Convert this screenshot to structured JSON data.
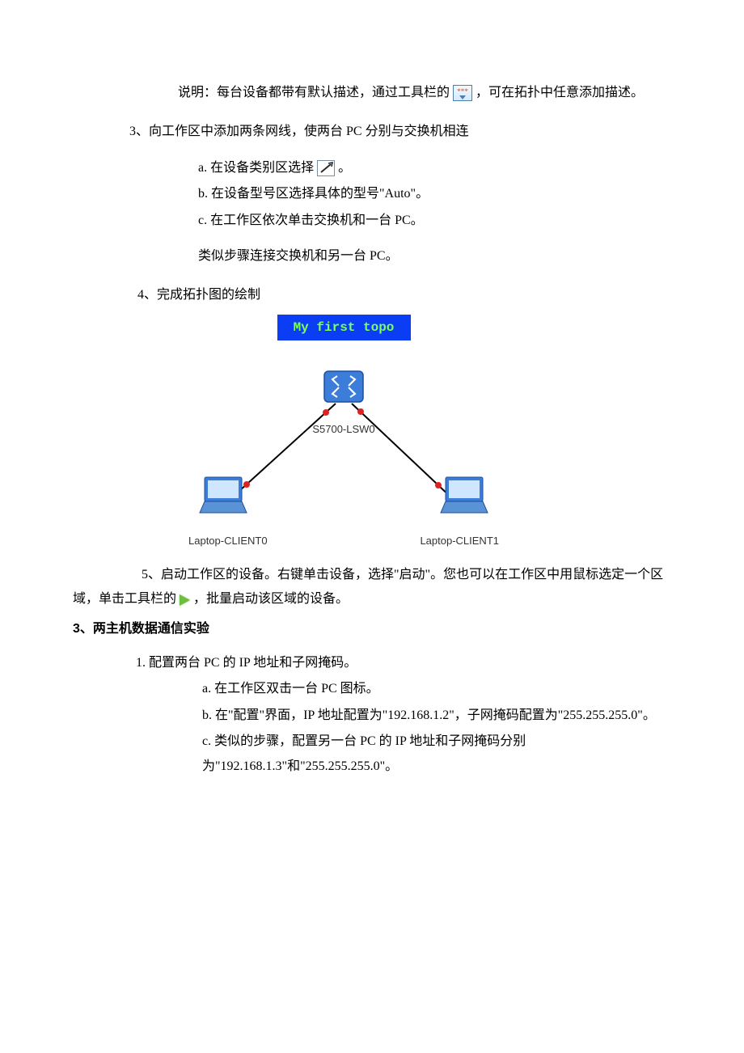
{
  "p1": {
    "pre": "说明：每台设备都带有默认描述，通过工具栏的 ",
    "post": "，可在拓扑中任意添加描述。",
    "icon_glyph": "***"
  },
  "s3": {
    "title": "3、向工作区中添加两条网线，使两台 PC 分别与交换机相连",
    "a_pre": "a.  在设备类别区选择  ",
    "a_post": "。",
    "b": "b.  在设备型号区选择具体的型号\"Auto\"。",
    "c": "c.  在工作区依次单击交换机和一台 PC。",
    "note": "类似步骤连接交换机和另一台 PC。"
  },
  "s4": {
    "title": "4、完成拓扑图的绘制"
  },
  "topo": {
    "title": "My first topo",
    "switch": "S5700-LSW0",
    "client0": "Laptop-CLIENT0",
    "client1": "Laptop-CLIENT1"
  },
  "s5": {
    "pre": "5、启动工作区的设备。右键单击设备，选择\"启动\"。您也可以在工作区中用鼠标选定一个区域，单击工具栏的 ",
    "post": "，批量启动该区域的设备。"
  },
  "sec3_title": "3、两主机数据通信实验",
  "c1": {
    "title": "1.  配置两台 PC 的 IP 地址和子网掩码。",
    "a": "a.  在工作区双击一台 PC 图标。",
    "b": "b.  在\"配置\"界面，IP 地址配置为\"192.168.1.2\"，子网掩码配置为\"255.255.255.0\"。",
    "c": "c.  类似的步骤，配置另一台 PC 的 IP 地址和子网掩码分别为\"192.168.1.3\"和\"255.255.255.0\"。"
  }
}
